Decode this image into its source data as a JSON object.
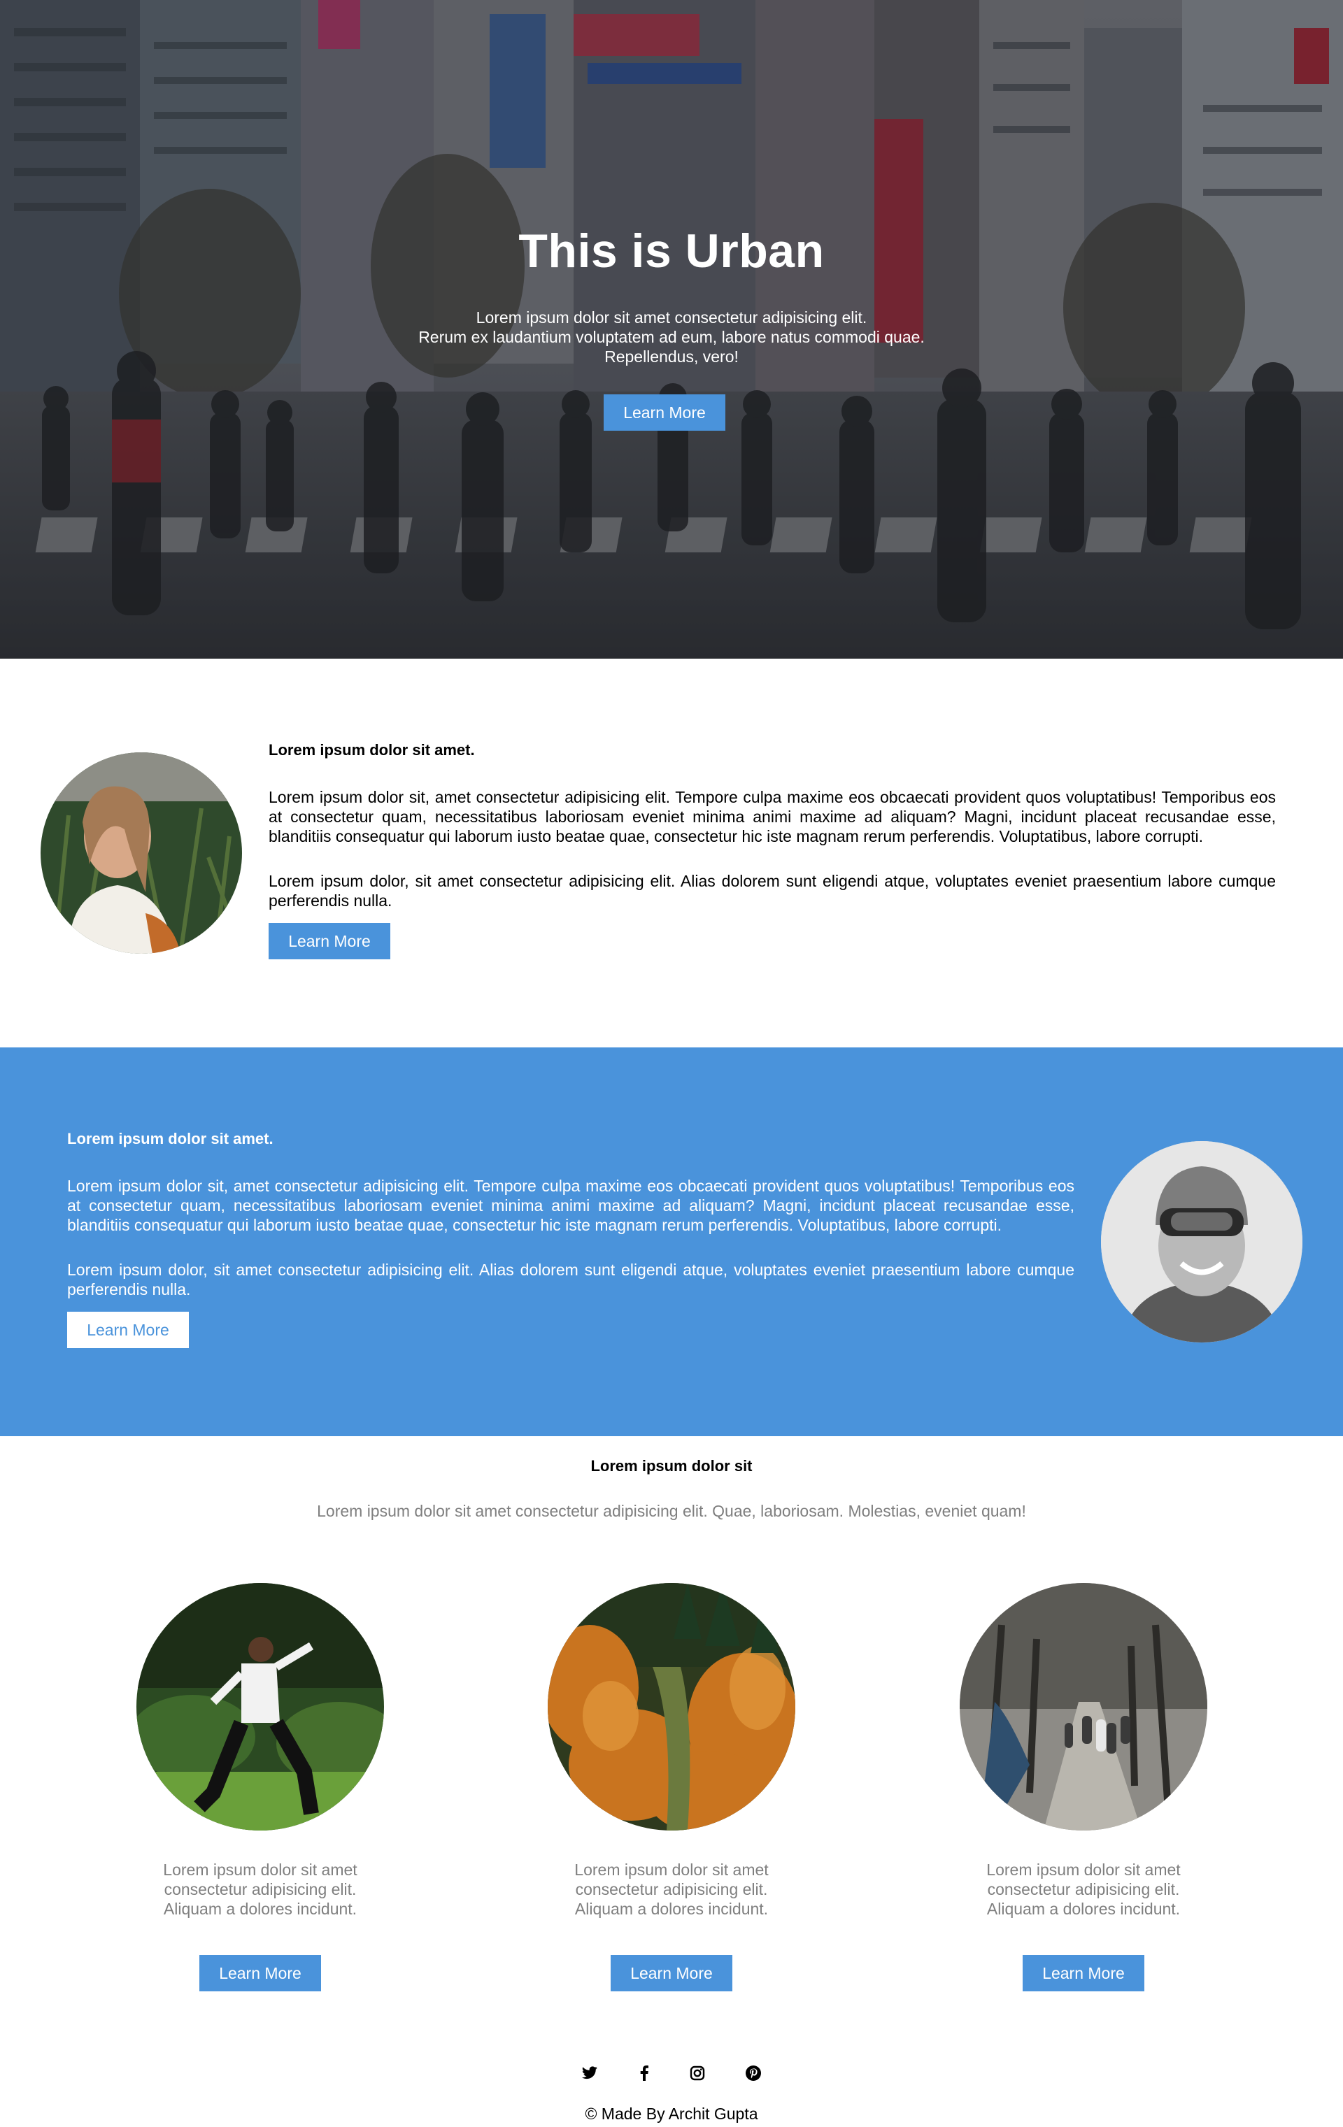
{
  "hero": {
    "title": "This is Urban",
    "lines": [
      "Lorem ipsum dolor sit amet consectetur adipisicing elit.",
      "Rerum ex laudantium voluptatem ad eum, labore natus commodi quae.",
      "Repellendus, vero!"
    ],
    "button_label": "Learn More"
  },
  "section_one": {
    "title": "Lorem ipsum dolor sit amet.",
    "paragraph_1": "Lorem ipsum dolor sit, amet consectetur adipisicing elit. Tempore culpa maxime eos obcaecati provident quos voluptatibus! Temporibus eos at consectetur quam, necessitatibus laboriosam eveniet minima animi maxime ad aliquam? Magni, incidunt placeat recusandae esse, blanditiis consequatur qui laborum iusto beatae quae, consectetur hic iste magnam rerum perferendis. Voluptatibus, labore corrupti.",
    "paragraph_2": "Lorem ipsum dolor, sit amet consectetur adipisicing elit. Alias dolorem sunt eligendi atque, voluptates eveniet praesentium labore cumque perferendis nulla.",
    "button_label": "Learn More"
  },
  "section_two": {
    "title": "Lorem ipsum dolor sit amet.",
    "paragraph_1": "Lorem ipsum dolor sit, amet consectetur adipisicing elit. Tempore culpa maxime eos obcaecati provident quos voluptatibus! Temporibus eos at consectetur quam, necessitatibus laboriosam eveniet minima animi maxime ad aliquam? Magni, incidunt placeat recusandae esse, blanditiis consequatur qui laborum iusto beatae quae, consectetur hic iste magnam rerum perferendis. Voluptatibus, labore corrupti.",
    "paragraph_2": "Lorem ipsum dolor, sit amet consectetur adipisicing elit. Alias dolorem sunt eligendi atque, voluptates eveniet praesentium labore cumque perferendis nulla.",
    "button_label": "Learn More"
  },
  "section_three": {
    "title": "Lorem ipsum dolor sit",
    "subtitle": "Lorem ipsum dolor sit amet consectetur adipisicing elit. Quae, laboriosam. Molestias, eveniet quam!",
    "cards": [
      {
        "lines": [
          "Lorem ipsum dolor sit amet",
          "consectetur adipisicing elit.",
          "Aliquam a dolores incidunt."
        ],
        "button_label": "Learn More"
      },
      {
        "lines": [
          "Lorem ipsum dolor sit amet",
          "consectetur adipisicing elit.",
          "Aliquam a dolores incidunt."
        ],
        "button_label": "Learn More"
      },
      {
        "lines": [
          "Lorem ipsum dolor sit amet",
          "consectetur adipisicing elit.",
          "Aliquam a dolores incidunt."
        ],
        "button_label": "Learn More"
      }
    ]
  },
  "footer": {
    "social_icons": [
      "twitter-icon",
      "facebook-icon",
      "instagram-icon",
      "pinterest-icon"
    ],
    "credit": "© Made By Archit Gupta"
  },
  "colors": {
    "accent": "#4a93db",
    "muted_text": "#7f7f7f"
  }
}
